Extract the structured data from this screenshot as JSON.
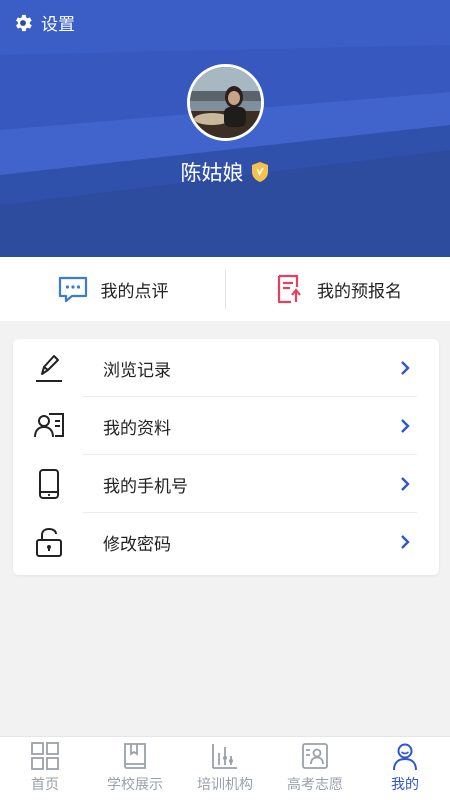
{
  "header": {
    "settings_label": "设置",
    "username": "陈姑娘",
    "colors": {
      "primary": "#3b5cc9",
      "verified_badge": "#f5c24c"
    }
  },
  "quick_actions": [
    {
      "label": "我的点评",
      "icon": "comment-icon"
    },
    {
      "label": "我的预报名",
      "icon": "pre-register-icon"
    }
  ],
  "menu": [
    {
      "label": "浏览记录",
      "icon": "pen-icon"
    },
    {
      "label": "我的资料",
      "icon": "profile-card-icon"
    },
    {
      "label": "我的手机号",
      "icon": "phone-icon"
    },
    {
      "label": "修改密码",
      "icon": "lock-icon"
    }
  ],
  "tabbar": {
    "active": "我的",
    "items": [
      {
        "label": "首页",
        "icon": "grid-icon"
      },
      {
        "label": "学校展示",
        "icon": "book-icon"
      },
      {
        "label": "培训机构",
        "icon": "chart-icon"
      },
      {
        "label": "高考志愿",
        "icon": "id-card-icon"
      },
      {
        "label": "我的",
        "icon": "user-icon"
      }
    ]
  }
}
